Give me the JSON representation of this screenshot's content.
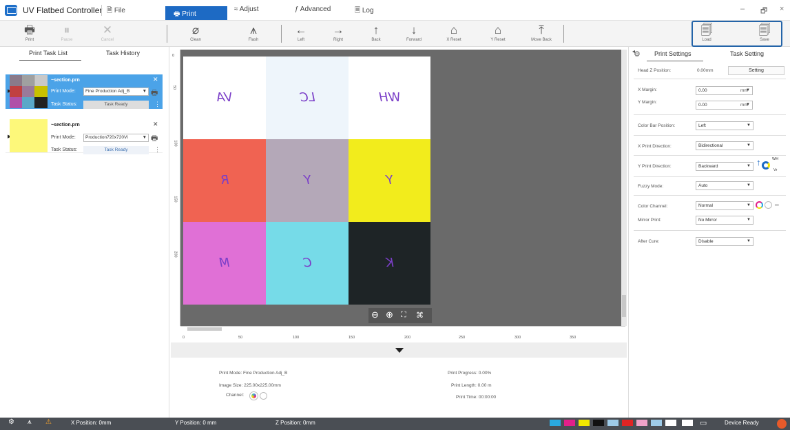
{
  "app": {
    "title": "UV Flatbed Controller"
  },
  "menu": {
    "file": "File",
    "print": "Print",
    "adjust": "Adjust",
    "advanced": "Advanced",
    "log": "Log"
  },
  "window": {
    "minimize": "–",
    "restore": "🗗",
    "close": "×"
  },
  "toolbar": {
    "print": "Print",
    "pause": "Pause",
    "cancel": "Cancel",
    "clean": "Clean",
    "flash": "Flash",
    "left": "Left",
    "right": "Right",
    "back": "Back",
    "forward": "Forward",
    "x_reset": "X Reset",
    "y_reset": "Y Reset",
    "move_back": "Move Back",
    "load": "Load",
    "save": "Save"
  },
  "left_tabs": {
    "task_list": "Print Task List",
    "task_history": "Task History"
  },
  "tasks": [
    {
      "name": "~section.prn",
      "mode_label": "Print Mode:",
      "mode": "Fine Production Adj_B",
      "status_label": "Task Status:",
      "status": "Task Ready"
    },
    {
      "name": "~section.prn",
      "mode_label": "Print Mode:",
      "mode": "Production720x720Vi",
      "status_label": "Task Status:",
      "status": "Task Ready"
    }
  ],
  "canvas": {
    "cells": [
      "VA",
      "LC",
      "WH",
      "R",
      "Y",
      "Y",
      "M",
      "C",
      "K"
    ]
  },
  "ruler": {
    "h": [
      "0",
      "50",
      "100",
      "150",
      "200",
      "250",
      "300",
      "350"
    ],
    "v": [
      "0",
      "50",
      "100",
      "150",
      "200"
    ]
  },
  "info": {
    "print_mode": "Print Mode: Fine Production Adj_B",
    "image_size": "Image Size: 225.00x225.00mm",
    "channel": "Channel:",
    "progress": "Print Progress: 0.00%",
    "length": "Print Length: 0.00 m",
    "time": "Print Time: 00:00:00"
  },
  "right_tabs": {
    "print_settings": "Print Settings",
    "task_setting": "Task Setting"
  },
  "settings": {
    "head_z_label": "Head Z Position:",
    "head_z_value": "0.00mm",
    "setting_button": "Setting",
    "x_margin_label": "X Margin:",
    "x_margin_value": "0.00",
    "y_margin_label": "Y Margin:",
    "y_margin_value": "0.00",
    "unit": "mm",
    "color_bar_label": "Color Bar Position:",
    "color_bar_value": "Left",
    "x_dir_label": "X Print Direction:",
    "x_dir_value": "Bidirectional",
    "y_dir_label": "Y Print Direction:",
    "y_dir_value": "Backward",
    "wh": "WH",
    "vr": "Vr",
    "fuzzy_label": "Fuzzy Mode:",
    "fuzzy_value": "Auto",
    "channel_label": "Color Channel:",
    "channel_value": "Normal",
    "mirror_label": "Mirror Print:",
    "mirror_value": "No Mirror",
    "after_cure_label": "After Cure:",
    "after_cure_value": "Disable"
  },
  "status": {
    "x": "X Position: 0mm",
    "y": "Y Position: 0 mm",
    "z": "Z Position: 0mm",
    "device": "Device Ready"
  },
  "colors": {
    "accent": "#1d6ac4",
    "selected_card": "#4ba3e8",
    "status_bg": "#4a4e54",
    "ink_c": "#2aa9e0",
    "ink_m": "#e2208a",
    "ink_y": "#f1e600",
    "ink_k": "#111111",
    "ink_lc": "#9ecbe8",
    "ink_lm": "#f0a2c8",
    "ink_r": "#e02424",
    "ink_w": "#ffffff"
  }
}
